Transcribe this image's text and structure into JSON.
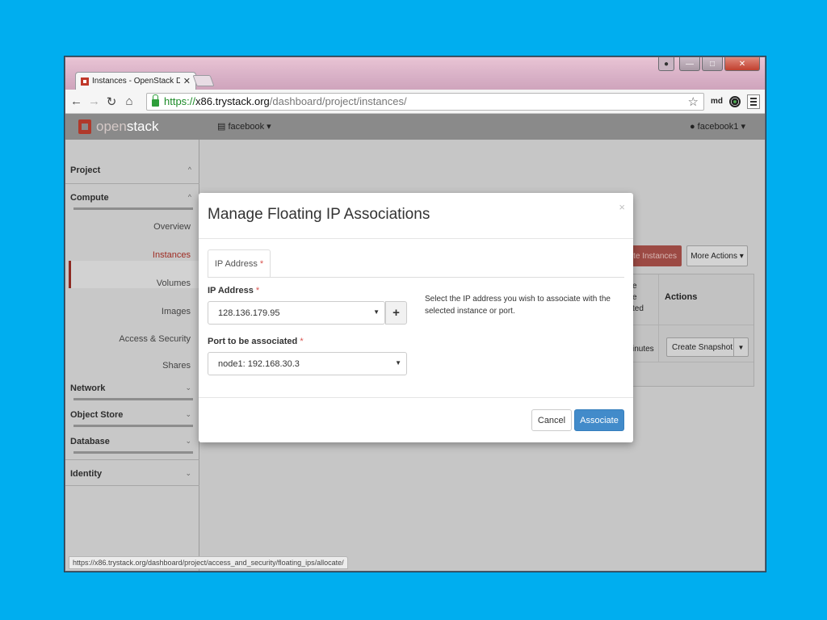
{
  "browser": {
    "tab_title": "Instances - OpenStack Da",
    "tab_close": "✕",
    "url_scheme": "https://",
    "url_host": "x86.trystack.org",
    "url_path": "/dashboard/project/instances/",
    "profile_label": "md",
    "status_url": "https://x86.trystack.org/dashboard/project/access_and_security/floating_ips/allocate/"
  },
  "topnav": {
    "logo_open": "open",
    "logo_stack": "stack",
    "project_menu": "facebook",
    "user_menu": "facebook1"
  },
  "sidebar": {
    "sections": {
      "project": "Project",
      "compute": "Compute",
      "network": "Network",
      "object_store": "Object Store",
      "database": "Database",
      "identity": "Identity"
    },
    "compute_items": [
      "Overview",
      "Instances",
      "Volumes",
      "Images",
      "Access & Security",
      "Shares"
    ],
    "active_item": "Instances"
  },
  "content": {
    "launch_button_fragment": "ate Instances",
    "more_actions_button": "More Actions ▾",
    "table_header_fragment_1": "e",
    "table_header_fragment_2": "e",
    "table_header_fragment_3": "ted",
    "table_actions_header": "Actions",
    "row_time_fragment": "inutes",
    "create_snapshot_button": "Create Snapshot"
  },
  "modal": {
    "title": "Manage Floating IP Associations",
    "close": "×",
    "tab_label": "IP Address",
    "ip_label": "IP Address",
    "ip_value": "128.136.179.95",
    "port_label": "Port to be associated",
    "port_value": "node1: 192.168.30.3",
    "required_marker": "*",
    "help_text": "Select the IP address you wish to associate with the selected instance or port.",
    "cancel_label": "Cancel",
    "associate_label": "Associate"
  },
  "colors": {
    "desktop": "#00aeef",
    "primary": "#428bca",
    "brand_red": "#b0392a"
  }
}
